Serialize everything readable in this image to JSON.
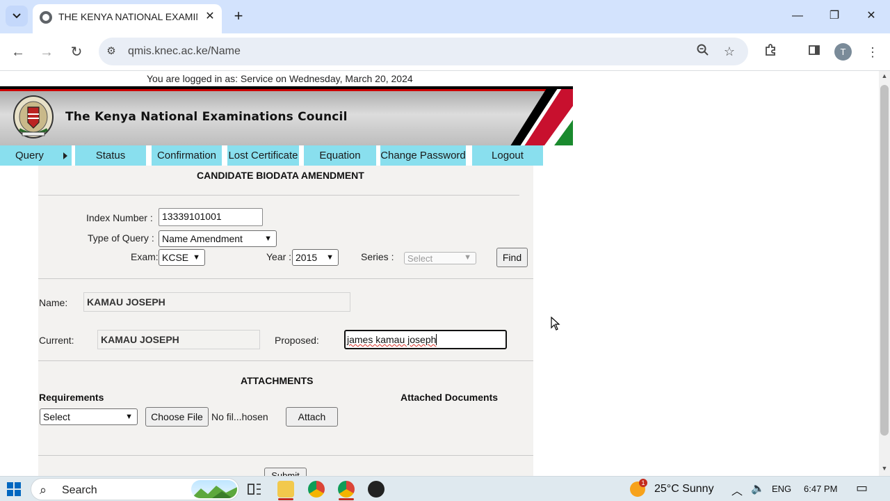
{
  "browser": {
    "tab_title": "THE KENYA NATIONAL EXAMINATIONS COUNCIL",
    "url": "qmis.knec.ac.ke/Name",
    "profile_initial": "T"
  },
  "page": {
    "login_status": "You are logged in as: Service on Wednesday, March 20, 2024",
    "header_title": "The Kenya National Examinations Council",
    "menu": [
      "Query",
      "Status",
      "Confirmation",
      "Lost Certificate",
      "Equation",
      "Change Password",
      "Logout"
    ],
    "form_title": "CANDIDATE BIODATA AMENDMENT",
    "index_label": "Index Number :",
    "index_value": "13339101001",
    "query_label": "Type of Query :",
    "query_value": "Name Amendment",
    "exam_label": "Exam:",
    "exam_value": "KCSE",
    "year_label": "Year :",
    "year_value": "2015",
    "series_label": "Series :",
    "series_value": "Select",
    "find_label": "Find",
    "name_label": "Name:",
    "name_value": "KAMAU JOSEPH",
    "current_label": "Current:",
    "current_value": "KAMAU JOSEPH",
    "proposed_label": "Proposed:",
    "proposed_value": "james kamau joseph",
    "attachments_title": "ATTACHMENTS",
    "requirements_label": "Requirements",
    "attached_label": "Attached Documents",
    "requirements_select": "Select",
    "choose_file_label": "Choose File",
    "no_file_text": "No fil...hosen",
    "attach_label": "Attach",
    "submit_label": "Submit"
  },
  "taskbar": {
    "search_placeholder": "Search",
    "weather": "25°C  Sunny",
    "weather_badge": "1",
    "language": "ENG",
    "time": "6:47 PM"
  },
  "colors": {
    "menu_bg": "#89dfee",
    "chrome_bg": "#d3e3fd",
    "panel_bg": "#f3f2f0"
  }
}
